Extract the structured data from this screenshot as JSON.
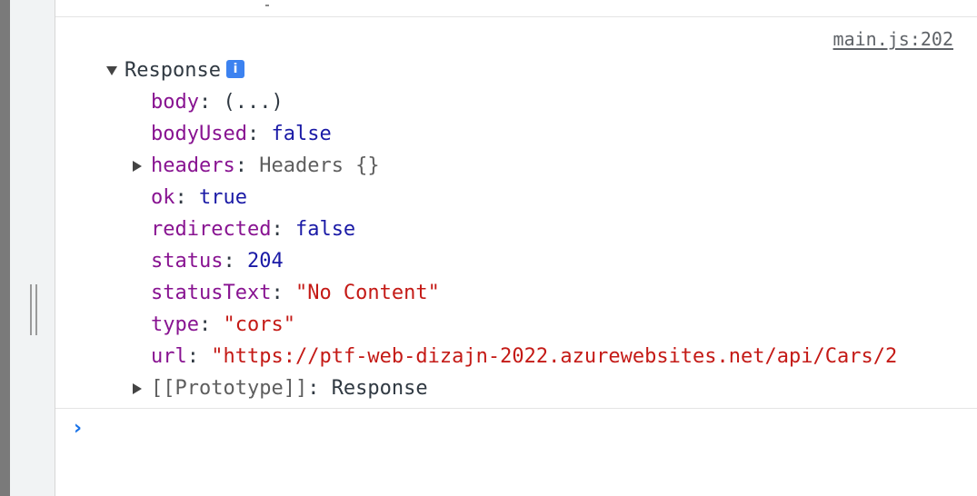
{
  "console": {
    "source_link": "main.js:202",
    "prompt_glyph": "›",
    "log": {
      "object_label": "Response",
      "info_badge": "i",
      "properties": {
        "body": {
          "key": "body",
          "sep": ": ",
          "value": "(...)"
        },
        "bodyUsed": {
          "key": "bodyUsed",
          "sep": ": ",
          "value": "false"
        },
        "headers": {
          "key": "headers",
          "sep": ": ",
          "value": "Headers {}"
        },
        "ok": {
          "key": "ok",
          "sep": ": ",
          "value": "true"
        },
        "redirected": {
          "key": "redirected",
          "sep": ": ",
          "value": "false"
        },
        "status": {
          "key": "status",
          "sep": ": ",
          "value": "204"
        },
        "statusText": {
          "key": "statusText",
          "sep": ": ",
          "value": "\"No Content\""
        },
        "type": {
          "key": "type",
          "sep": ": ",
          "value": "\"cors\""
        },
        "url": {
          "key": "url",
          "sep": ": ",
          "value": "\"https://ptf-web-dizajn-2022.azurewebsites.net/api/Cars/2"
        },
        "prototype": {
          "key": "[[Prototype]]",
          "sep": ": ",
          "value": "Response"
        }
      }
    }
  },
  "colors": {
    "key": "#881391",
    "string": "#c41a16",
    "keyword": "#1a1aa6",
    "info_badge": "#3c82f0",
    "prompt": "#1a73e8"
  },
  "icons": [
    "expand-down-icon",
    "expand-right-icon",
    "info-icon",
    "chevron-right-icon",
    "drag-handle-icon"
  ]
}
